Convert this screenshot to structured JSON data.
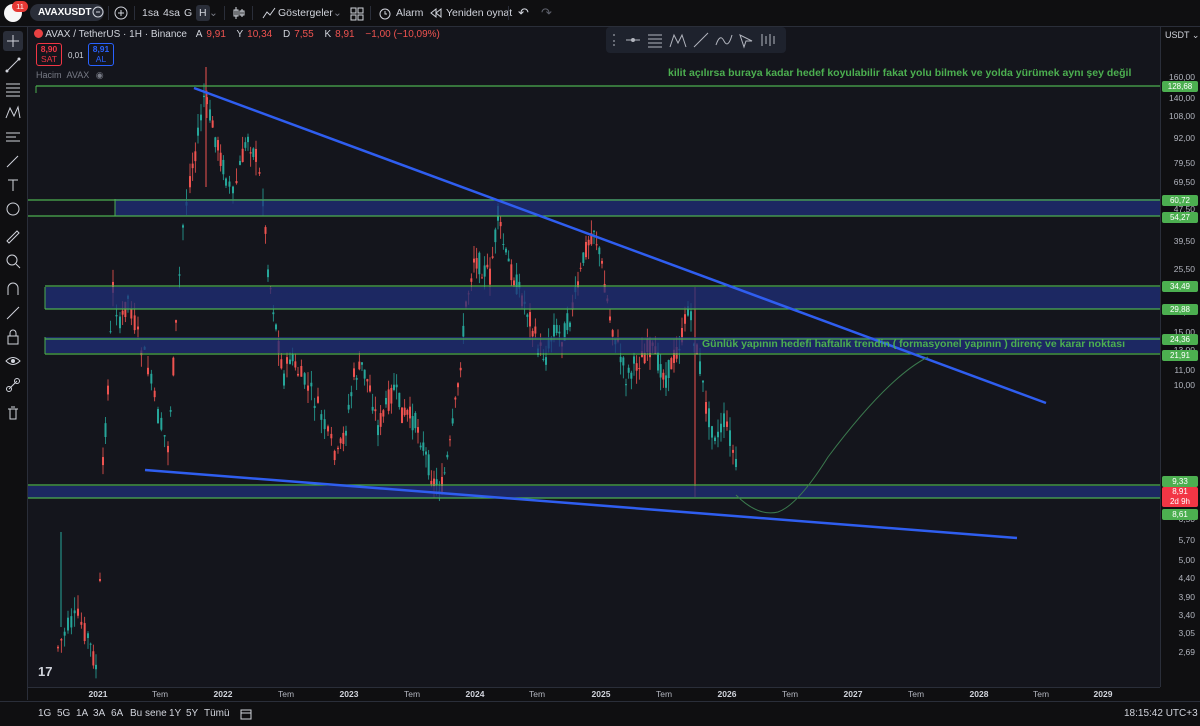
{
  "topbar": {
    "notification_count": "11",
    "symbol": "AVAXUSDT",
    "intervals": [
      "1sa",
      "4sa",
      "G",
      "H"
    ],
    "indicators_label": "Göstergeler",
    "alarm_label": "Alarm",
    "replay_label": "Yeniden oynat"
  },
  "legend": {
    "title": "AVAX / TetherUS · 1H · Binance",
    "open_label": "A",
    "open_value": "9,91",
    "high_label": "Y",
    "high_value": "10,34",
    "low_label": "D",
    "low_value": "7,55",
    "close_label": "K",
    "close_value": "8,91",
    "change": "−1,00 (−10,09%)",
    "sell_price": "8,90",
    "sell_label": "SAT",
    "spread": "0,01",
    "buy_price": "8,91",
    "buy_label": "AL",
    "volume_label": "Hacim",
    "volume_symbol": "AVAX"
  },
  "annotations": {
    "top_note": "kilit açılırsa buraya kadar hedef koyulabilir fakat yolu bilmek ve yolda yürümek aynı şey değil",
    "mid_note": "Günlük yapının hedefi haftalık trendin ( formasyonel yapının ) direnç ve karar noktası"
  },
  "price_axis": {
    "currency": "USDT",
    "labels": [
      "160,00",
      "140,00",
      "108,00",
      "92,00",
      "79,50",
      "69,50",
      "47,50",
      "39,50",
      "25,50",
      "19,50",
      "17,00",
      "15,00",
      "13,00",
      "11,00",
      "10,00",
      "7,50",
      "6,50",
      "5,70",
      "5,00",
      "4,40",
      "3,90",
      "3,40",
      "3,05",
      "2,69"
    ],
    "level_tags": [
      {
        "value": "128,68",
        "color": "#4caf50"
      },
      {
        "value": "60,72",
        "color": "#4caf50"
      },
      {
        "value": "54,27",
        "color": "#4caf50"
      },
      {
        "value": "34,49",
        "color": "#4caf50"
      },
      {
        "value": "29,88",
        "color": "#4caf50"
      },
      {
        "value": "24,36",
        "color": "#4caf50"
      },
      {
        "value": "21,91",
        "color": "#4caf50"
      },
      {
        "value": "9,33",
        "color": "#4caf50"
      },
      {
        "value": "8,61",
        "color": "#4caf50"
      }
    ],
    "current_price": "8,91",
    "countdown": "2d 9h"
  },
  "time_axis": {
    "labels": [
      {
        "text": "2021",
        "year": true
      },
      {
        "text": "Tem",
        "year": false
      },
      {
        "text": "2022",
        "year": true
      },
      {
        "text": "Tem",
        "year": false
      },
      {
        "text": "2023",
        "year": true
      },
      {
        "text": "Tem",
        "year": false
      },
      {
        "text": "2024",
        "year": true
      },
      {
        "text": "Tem",
        "year": false
      },
      {
        "text": "2025",
        "year": true
      },
      {
        "text": "Tem",
        "year": false
      },
      {
        "text": "2026",
        "year": true
      },
      {
        "text": "Tem",
        "year": false
      },
      {
        "text": "2027",
        "year": true
      },
      {
        "text": "Tem",
        "year": false
      },
      {
        "text": "2028",
        "year": true
      },
      {
        "text": "Tem",
        "year": false
      },
      {
        "text": "2029",
        "year": true
      }
    ]
  },
  "bottombar": {
    "ranges": [
      "1G",
      "5G",
      "1A",
      "3A",
      "6A",
      "Bu sene",
      "1Y",
      "5Y",
      "Tümü"
    ],
    "clock": "18:15:42 UTC+3"
  },
  "colors": {
    "up": "#26a69a",
    "down": "#ef5350",
    "trendline": "#2f5ef0",
    "level": "#4caf50",
    "zone": "#1f2f7a"
  }
}
